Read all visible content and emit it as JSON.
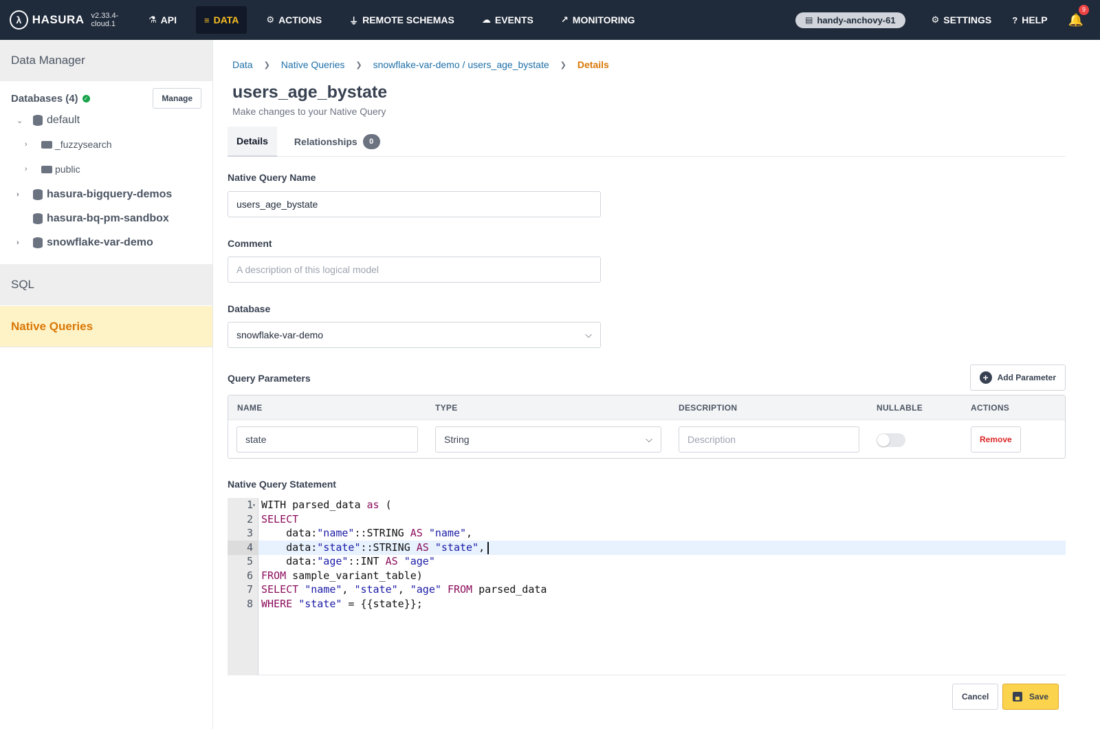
{
  "header": {
    "logo_text": "HASURA",
    "version": "v2.33.4-cloud.1",
    "nav": [
      {
        "label": "API",
        "icon": "flask-icon"
      },
      {
        "label": "DATA",
        "icon": "database-icon"
      },
      {
        "label": "ACTIONS",
        "icon": "gears-icon"
      },
      {
        "label": "REMOTE SCHEMAS",
        "icon": "plug-icon"
      },
      {
        "label": "EVENTS",
        "icon": "cloud-icon"
      },
      {
        "label": "MONITORING",
        "icon": "chart-icon"
      }
    ],
    "project": "handy-anchovy-61",
    "settings": "SETTINGS",
    "help": "HELP",
    "notifications": "9",
    "colors": {
      "bar": "#1f2a3a",
      "active": "#fbbf24"
    }
  },
  "sidebar": {
    "title": "Data Manager",
    "databases_label": "Databases (4)",
    "manage": "Manage",
    "tree": {
      "default": "default",
      "fuzzysearch": "_fuzzysearch",
      "public": "public",
      "bigquery": "hasura-bigquery-demos",
      "bq_sandbox": "hasura-bq-pm-sandbox",
      "snowflake": "snowflake-var-demo"
    },
    "sql": "SQL",
    "native_queries": "Native Queries"
  },
  "breadcrumb": {
    "data": "Data",
    "native_queries": "Native Queries",
    "path": "snowflake-var-demo / users_age_bystate",
    "current": "Details"
  },
  "page": {
    "title": "users_age_bystate",
    "subtitle": "Make changes to your Native Query"
  },
  "tabs": {
    "details": "Details",
    "relationships": "Relationships",
    "relationships_count": "0"
  },
  "form": {
    "name_label": "Native Query Name",
    "name_value": "users_age_bystate",
    "comment_label": "Comment",
    "comment_placeholder": "A description of this logical model",
    "database_label": "Database",
    "database_value": "snowflake-var-demo",
    "params_label": "Query Parameters",
    "add_param": "Add Parameter",
    "statement_label": "Native Query Statement"
  },
  "params": {
    "headers": {
      "name": "NAME",
      "type": "TYPE",
      "description": "DESCRIPTION",
      "nullable": "NULLABLE",
      "actions": "ACTIONS"
    },
    "row": {
      "name": "state",
      "type": "String",
      "description_placeholder": "Description",
      "nullable": false,
      "remove": "Remove"
    }
  },
  "code": {
    "lines": [
      "1",
      "2",
      "3",
      "4",
      "5",
      "6",
      "7",
      "8"
    ],
    "l1": {
      "a": "WITH parsed_data ",
      "b": "as",
      "c": " ("
    },
    "l2": {
      "a": "SELECT"
    },
    "l3": {
      "a": "    data:",
      "b": "\"name\"",
      "c": "::STRING ",
      "d": "AS",
      "e": " ",
      "f": "\"name\"",
      "g": ","
    },
    "l4": {
      "a": "    data:",
      "b": "\"state\"",
      "c": "::STRING ",
      "d": "AS",
      "e": " ",
      "f": "\"state\"",
      "g": ","
    },
    "l5": {
      "a": "    data:",
      "b": "\"age\"",
      "c": "::INT ",
      "d": "AS",
      "e": " ",
      "f": "\"age\""
    },
    "l6": {
      "a": "FROM",
      "b": " sample_variant_table)"
    },
    "l7": {
      "a": "SELECT",
      "b": " ",
      "c": "\"name\"",
      "d": ", ",
      "e": "\"state\"",
      "f": ", ",
      "g": "\"age\"",
      "h": " ",
      "i": "FROM",
      "j": " parsed_data"
    },
    "l8": {
      "a": "WHERE",
      "b": " ",
      "c": "\"state\"",
      "d": " = {{state}};"
    }
  },
  "footer": {
    "cancel": "Cancel",
    "save": "Save"
  }
}
